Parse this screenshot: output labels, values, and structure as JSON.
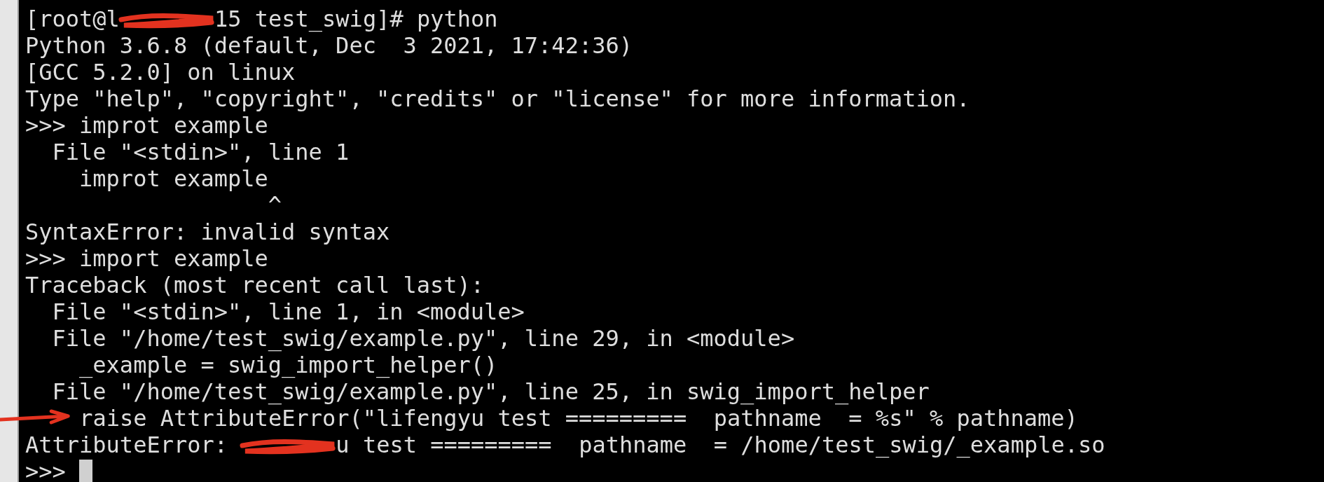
{
  "terminal": {
    "lines": [
      {
        "segments": [
          {
            "kind": "text",
            "text": "[root@l"
          },
          {
            "kind": "scribble"
          },
          {
            "kind": "text",
            "text": "15 test_swig]# python"
          }
        ]
      },
      {
        "segments": [
          {
            "kind": "text",
            "text": "Python 3.6.8 (default, Dec  3 2021, 17:42:36)"
          }
        ]
      },
      {
        "segments": [
          {
            "kind": "text",
            "text": "[GCC 5.2.0] on linux"
          }
        ]
      },
      {
        "segments": [
          {
            "kind": "text",
            "text": "Type \"help\", \"copyright\", \"credits\" or \"license\" for more information."
          }
        ]
      },
      {
        "segments": [
          {
            "kind": "text",
            "text": ">>> improt example"
          }
        ]
      },
      {
        "segments": [
          {
            "kind": "text",
            "text": "  File \"<stdin>\", line 1"
          }
        ]
      },
      {
        "segments": [
          {
            "kind": "text",
            "text": "    improt example"
          }
        ]
      },
      {
        "segments": [
          {
            "kind": "text",
            "text": "                  ^"
          }
        ]
      },
      {
        "segments": [
          {
            "kind": "text",
            "text": "SyntaxError: invalid syntax"
          }
        ]
      },
      {
        "segments": [
          {
            "kind": "text",
            "text": ">>> import example"
          }
        ]
      },
      {
        "segments": [
          {
            "kind": "text",
            "text": "Traceback (most recent call last):"
          }
        ]
      },
      {
        "segments": [
          {
            "kind": "text",
            "text": "  File \"<stdin>\", line 1, in <module>"
          }
        ]
      },
      {
        "segments": [
          {
            "kind": "text",
            "text": "  File \"/home/test_swig/example.py\", line 29, in <module>"
          }
        ]
      },
      {
        "segments": [
          {
            "kind": "text",
            "text": "    _example = swig_import_helper()"
          }
        ]
      },
      {
        "segments": [
          {
            "kind": "text",
            "text": "  File \"/home/test_swig/example.py\", line 25, in swig_import_helper"
          }
        ]
      },
      {
        "segments": [
          {
            "kind": "arrow"
          },
          {
            "kind": "text",
            "text": "raise AttributeError(\"lifengyu test =========  pathname  = %s\" % pathname)"
          }
        ]
      },
      {
        "segments": [
          {
            "kind": "text",
            "text": "AttributeError: "
          },
          {
            "kind": "scribble"
          },
          {
            "kind": "text",
            "text": "u test =========  pathname  = /home/test_swig/_example.so"
          }
        ]
      },
      {
        "segments": [
          {
            "kind": "text",
            "text": ">>> "
          },
          {
            "kind": "cursor"
          }
        ]
      }
    ]
  }
}
